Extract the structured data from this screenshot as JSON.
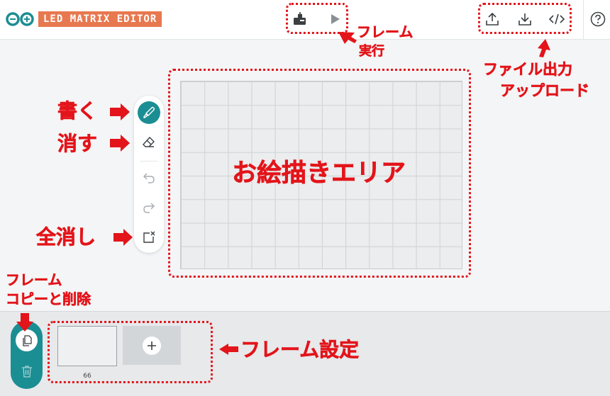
{
  "header": {
    "app_title": "LED MATRIX EDITOR",
    "logo_icon": "arduino-infinity-logo",
    "icons": [
      "frame-loader-icon",
      "play-icon",
      "upload-icon",
      "download-icon",
      "code-icon",
      "help-icon"
    ]
  },
  "colors": {
    "accent": "#1b8e93",
    "title_bg": "#e8784f",
    "annotation": "#e3141a"
  },
  "tools": [
    "brush-icon",
    "eraser-icon",
    "undo-icon",
    "redo-icon",
    "clear-canvas-icon"
  ],
  "frames": {
    "items": [
      {
        "number": "66"
      }
    ]
  },
  "annotations": {
    "frame_run": {
      "line1": "フレーム",
      "line2": "実行"
    },
    "file_io": {
      "line1": "ファイル出力",
      "line2": "アップロード"
    },
    "draw": "書く",
    "erase": "消す",
    "clear_all": "全消し",
    "canvas_area": "お絵描きエリア",
    "frame_copy": {
      "line1": "フレーム",
      "line2": "コピーと削除"
    },
    "frame_settings": "フレーム設定"
  }
}
